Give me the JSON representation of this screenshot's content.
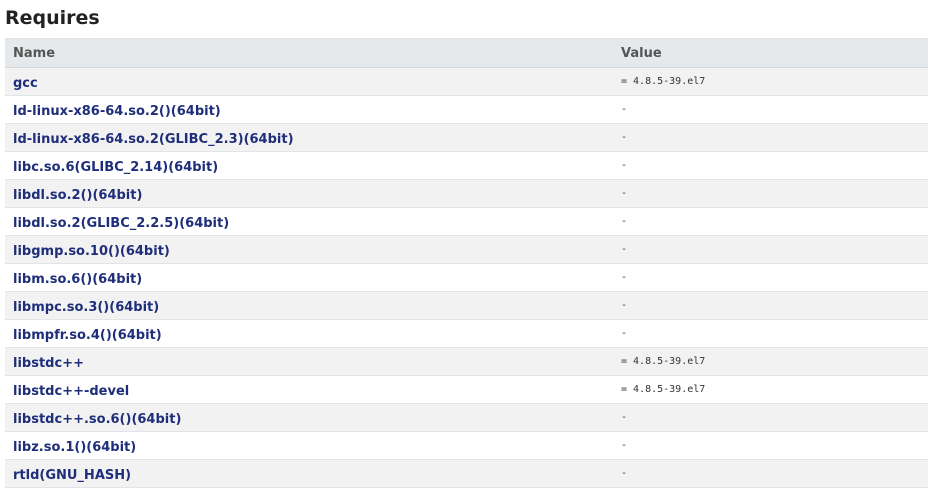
{
  "section": {
    "title": "Requires"
  },
  "table": {
    "headers": {
      "name": "Name",
      "value": "Value"
    },
    "rows": [
      {
        "name": "gcc",
        "value": "= 4.8.5-39.el7"
      },
      {
        "name": "ld-linux-x86-64.so.2()(64bit)",
        "value": "-"
      },
      {
        "name": "ld-linux-x86-64.so.2(GLIBC_2.3)(64bit)",
        "value": "-"
      },
      {
        "name": "libc.so.6(GLIBC_2.14)(64bit)",
        "value": "-"
      },
      {
        "name": "libdl.so.2()(64bit)",
        "value": "-"
      },
      {
        "name": "libdl.so.2(GLIBC_2.2.5)(64bit)",
        "value": "-"
      },
      {
        "name": "libgmp.so.10()(64bit)",
        "value": "-"
      },
      {
        "name": "libm.so.6()(64bit)",
        "value": "-"
      },
      {
        "name": "libmpc.so.3()(64bit)",
        "value": "-"
      },
      {
        "name": "libmpfr.so.4()(64bit)",
        "value": "-"
      },
      {
        "name": "libstdc++",
        "value": "= 4.8.5-39.el7"
      },
      {
        "name": "libstdc++-devel",
        "value": "= 4.8.5-39.el7"
      },
      {
        "name": "libstdc++.so.6()(64bit)",
        "value": "-"
      },
      {
        "name": "libz.so.1()(64bit)",
        "value": "-"
      },
      {
        "name": "rtld(GNU_HASH)",
        "value": "-"
      }
    ]
  }
}
